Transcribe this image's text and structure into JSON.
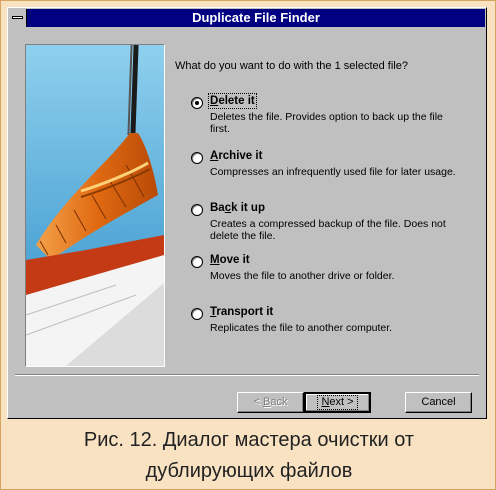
{
  "window": {
    "title": "Duplicate File Finder",
    "question": "What do you want to do with the 1 selected file?"
  },
  "options": [
    {
      "label_pre": "",
      "label_ul": "D",
      "label_post": "elete it",
      "description": "Deletes the file.  Provides option to back up the file first.",
      "selected": true
    },
    {
      "label_pre": "",
      "label_ul": "A",
      "label_post": "rchive it",
      "description": "Compresses an infrequently used file for later usage.",
      "selected": false
    },
    {
      "label_pre": "Ba",
      "label_ul": "c",
      "label_post": "k it up",
      "description": "Creates a compressed backup of the file.  Does not delete the file.",
      "selected": false
    },
    {
      "label_pre": "",
      "label_ul": "M",
      "label_post": "ove it",
      "description": "Moves the file to another drive or folder.",
      "selected": false
    },
    {
      "label_pre": "",
      "label_ul": "T",
      "label_post": "ransport it",
      "description": "Replicates the file to another computer.",
      "selected": false
    }
  ],
  "buttons": {
    "back": {
      "pre": "< ",
      "ul": "B",
      "post": "ack",
      "enabled": false
    },
    "next": {
      "pre": "",
      "ul": "N",
      "post": "ext >",
      "enabled": true
    },
    "cancel": {
      "label": "Cancel"
    }
  },
  "caption": {
    "line1": "Рис. 12. Диалог мастера очистки от",
    "line2": "дублирующих файлов"
  },
  "icons": {
    "system_menu": "system-menu-icon",
    "illustration": "broom-sweeping-illustration"
  }
}
